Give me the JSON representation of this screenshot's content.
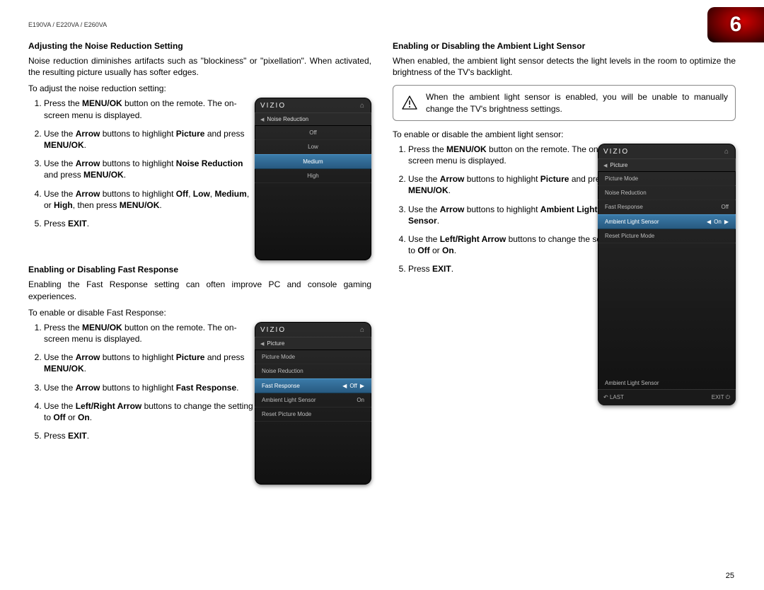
{
  "header": {
    "model_line": "E190VA / E220VA / E260VA"
  },
  "chapter": {
    "number": "6"
  },
  "page_number": "25",
  "left": {
    "s1": {
      "title": "Adjusting the Noise Reduction Setting",
      "body": "Noise reduction diminishes artifacts such as \"blockiness\" or \"pixellation\". When activated, the resulting picture usually has softer edges.",
      "lead": "To adjust the noise reduction setting:",
      "steps": {
        "i1a": "Press the ",
        "i1b": "MENU/OK",
        "i1c": " button on the remote. The on-screen menu is displayed.",
        "i2a": "Use the ",
        "i2b": "Arrow",
        "i2c": " buttons to highlight ",
        "i2d": "Picture",
        "i2e": " and press ",
        "i2f": "MENU/OK",
        "i2g": ".",
        "i3a": "Use the ",
        "i3b": "Arrow",
        "i3c": " buttons to highlight ",
        "i3d": "Noise Reduction",
        "i3e": " and press ",
        "i3f": "MENU/OK",
        "i3g": ".",
        "i4a": "Use the ",
        "i4b": "Arrow",
        "i4c": " buttons to highlight ",
        "i4d": "Off",
        "i4e": ", ",
        "i4f": "Low",
        "i4g": ", ",
        "i4h": "Medium",
        "i4i": ", or ",
        "i4j": "High",
        "i4k": ", then press ",
        "i4l": "MENU/OK",
        "i4m": ".",
        "i5a": "Press ",
        "i5b": "EXIT",
        "i5c": "."
      }
    },
    "s2": {
      "title": "Enabling or Disabling Fast Response",
      "body": "Enabling the Fast Response setting can often improve PC and console gaming experiences.",
      "lead": "To enable or disable Fast Response:",
      "steps": {
        "i1a": "Press the ",
        "i1b": "MENU/OK",
        "i1c": " button on the remote. The on-screen menu is displayed.",
        "i2a": "Use the ",
        "i2b": "Arrow",
        "i2c": " buttons to highlight ",
        "i2d": "Picture",
        "i2e": " and press ",
        "i2f": "MENU/OK",
        "i2g": ".",
        "i3a": "Use the ",
        "i3b": "Arrow",
        "i3c": " buttons to highlight ",
        "i3d": "Fast Response",
        "i3e": ".",
        "i4a": "Use the ",
        "i4b": "Left/Right Arrow",
        "i4c": " buttons to change the setting to ",
        "i4d": "Off",
        "i4e": " or ",
        "i4f": "On",
        "i4g": ".",
        "i5a": "Press ",
        "i5b": "EXIT",
        "i5c": "."
      }
    }
  },
  "right": {
    "s1": {
      "title": "Enabling or Disabling the Ambient Light Sensor",
      "body": "When enabled, the ambient light sensor detects the light levels in the room to optimize the brightness of the TV's backlight.",
      "note": "When the ambient light sensor is enabled, you will be unable to manually change the TV's brightness settings.",
      "lead": "To enable or disable the ambient light sensor:",
      "steps": {
        "i1a": "Press the ",
        "i1b": "MENU/OK",
        "i1c": " button on the remote. The on-screen menu is displayed.",
        "i2a": "Use the ",
        "i2b": "Arrow",
        "i2c": " buttons to highlight ",
        "i2d": "Picture",
        "i2e": " and press ",
        "i2f": "MENU/OK",
        "i2g": ".",
        "i3a": "Use the ",
        "i3b": "Arrow",
        "i3c": " buttons to highlight ",
        "i3d": "Ambient Light Sensor",
        "i3e": ".",
        "i4a": "Use the ",
        "i4b": "Left/Right Arrow",
        "i4c": " buttons to change the setting to ",
        "i4d": "Off",
        "i4e": " or ",
        "i4f": "On",
        "i4g": ".",
        "i5a": "Press ",
        "i5b": "EXIT",
        "i5c": "."
      }
    }
  },
  "devices": {
    "brand": "VIZIO",
    "d1": {
      "crumb": "Noise Reduction",
      "opts": {
        "o1": "Off",
        "o2": "Low",
        "o3": "Medium",
        "o4": "High"
      }
    },
    "d2": {
      "crumb": "Picture",
      "r1": "Picture Mode",
      "r2": "Noise Reduction",
      "r3": "Fast Response",
      "r3v": "Off",
      "r4": "Ambient Light Sensor",
      "r4v": "On",
      "r5": "Reset Picture Mode"
    },
    "d3": {
      "crumb": "Picture",
      "r1": "Picture Mode",
      "r2": "Noise Reduction",
      "r3": "Fast Response",
      "r3v": "Off",
      "r4": "Ambient Light Sensor",
      "r4v": "On",
      "r5": "Reset Picture Mode",
      "desc": "Ambient Light Sensor",
      "last": "LAST",
      "exit": "EXIT"
    }
  }
}
